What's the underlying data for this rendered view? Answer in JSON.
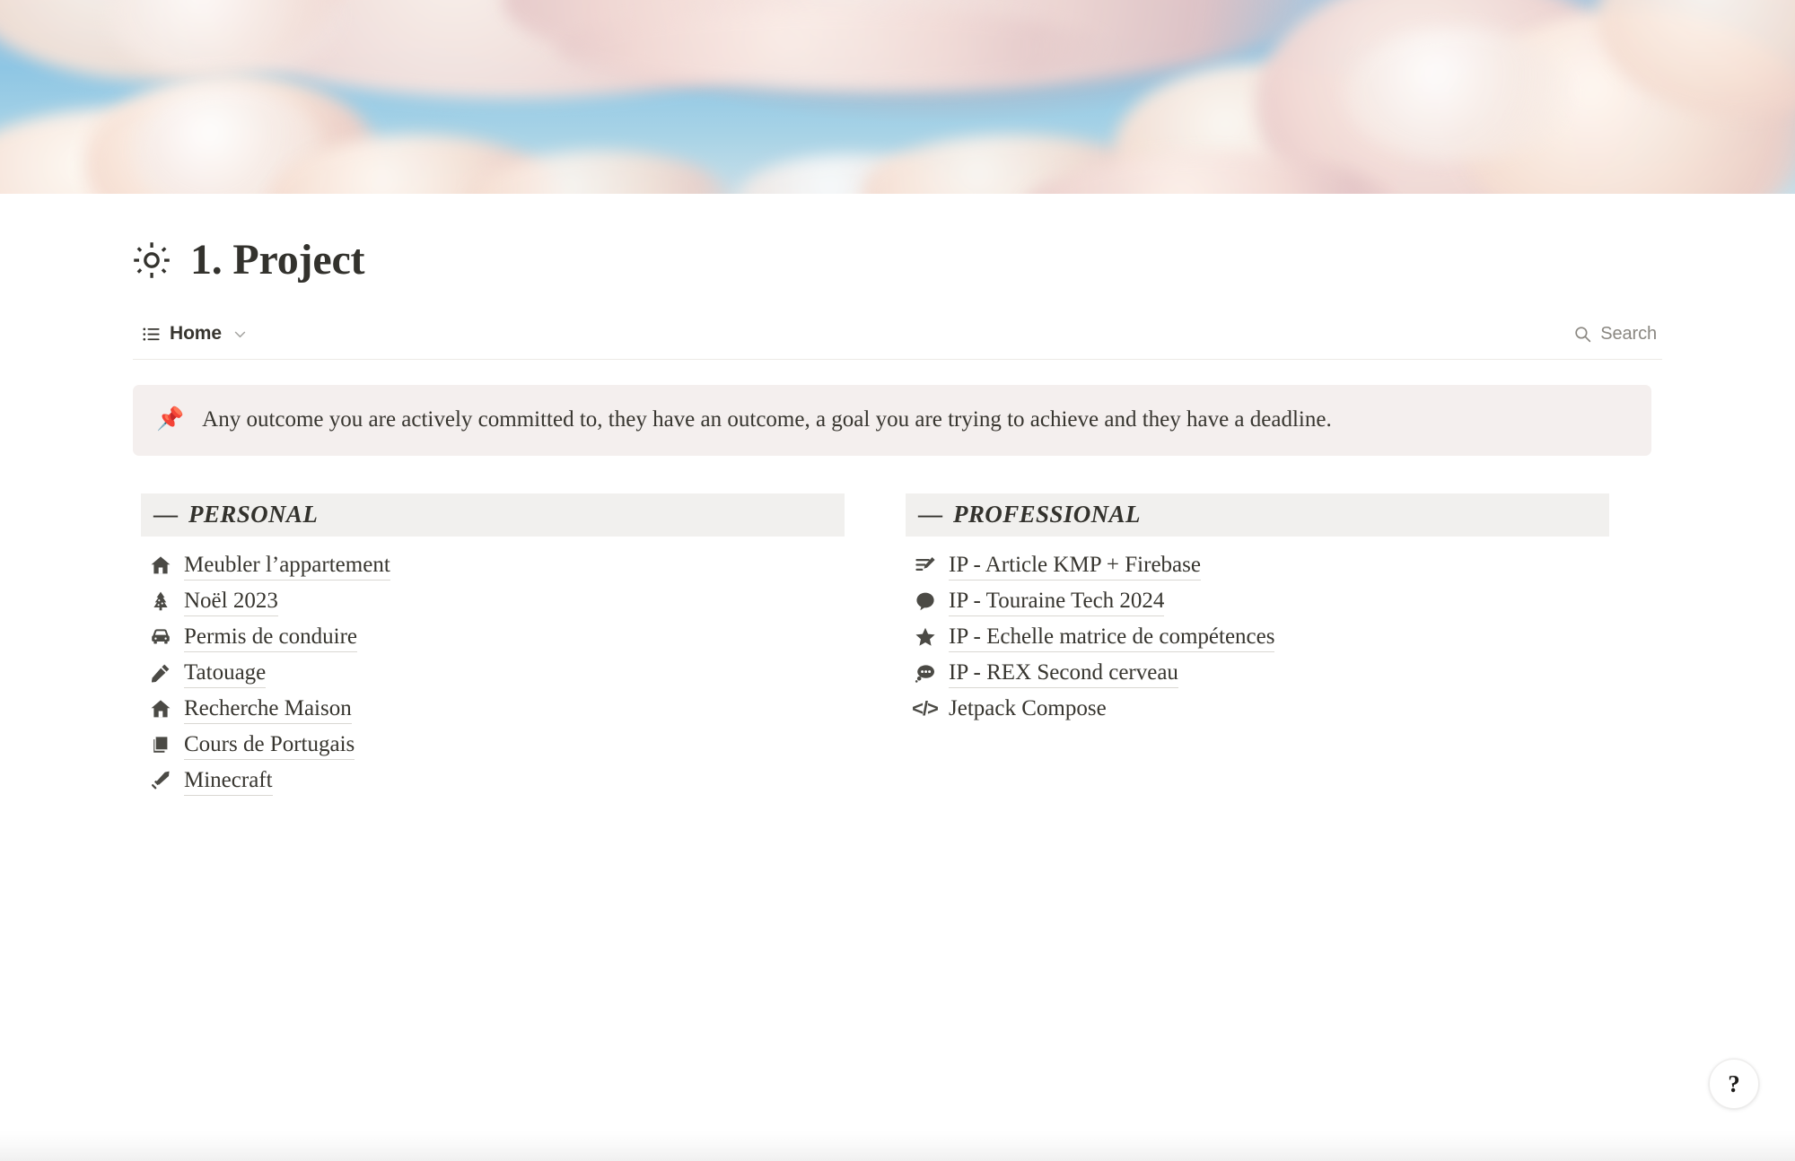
{
  "cover": {
    "alt": "pastel sky with pink clouds"
  },
  "header": {
    "icon": "sun-icon",
    "title": "1. Project"
  },
  "navbar": {
    "view_icon": "list-icon",
    "view_label": "Home",
    "chevron_icon": "chevron-down-icon",
    "search_icon": "search-icon",
    "search_label": "Search"
  },
  "callout": {
    "emoji": "📌",
    "emoji_name": "pushpin-icon",
    "text": "Any outcome you are actively committed to, they have an outcome, a goal you are trying to achieve and they have a deadline.",
    "background": "#f4efee"
  },
  "sections": [
    {
      "dash": "—",
      "title": "PERSONAL",
      "band_color": "#f1f0ee",
      "items": [
        {
          "icon": "house-icon",
          "label": "Meubler l’appartement",
          "underline": true
        },
        {
          "icon": "christmas-tree-icon",
          "label": "Noël 2023",
          "underline": true
        },
        {
          "icon": "car-icon",
          "label": "Permis de conduire",
          "underline": true
        },
        {
          "icon": "pencil-icon",
          "label": "Tatouage",
          "underline": true
        },
        {
          "icon": "house-icon",
          "label": "Recherche Maison",
          "underline": true
        },
        {
          "icon": "book-icon",
          "label": "Cours de Portugais",
          "underline": true
        },
        {
          "icon": "sword-icon",
          "label": "Minecraft",
          "underline": true
        }
      ]
    },
    {
      "dash": "—",
      "title": "PROFESSIONAL",
      "band_color": "#f1f0ee",
      "items": [
        {
          "icon": "edit-lines-icon",
          "label": "IP - Article KMP + Firebase",
          "underline": true
        },
        {
          "icon": "speech-bubble-icon",
          "label": "IP - Touraine Tech 2024",
          "underline": true
        },
        {
          "icon": "star-icon",
          "label": "IP - Echelle matrice de compétences",
          "underline": true
        },
        {
          "icon": "thought-bubble-icon",
          "label": "IP - REX Second cerveau",
          "underline": true
        },
        {
          "icon": "code-icon",
          "label": "Jetpack Compose",
          "underline": false
        }
      ]
    }
  ],
  "help_button": {
    "label": "?",
    "name": "help-button"
  },
  "colors": {
    "text": "#37352f",
    "muted": "#8a8781",
    "band": "#f1f0ee",
    "callout": "#f4efee",
    "underline": "#d9d7d2"
  }
}
